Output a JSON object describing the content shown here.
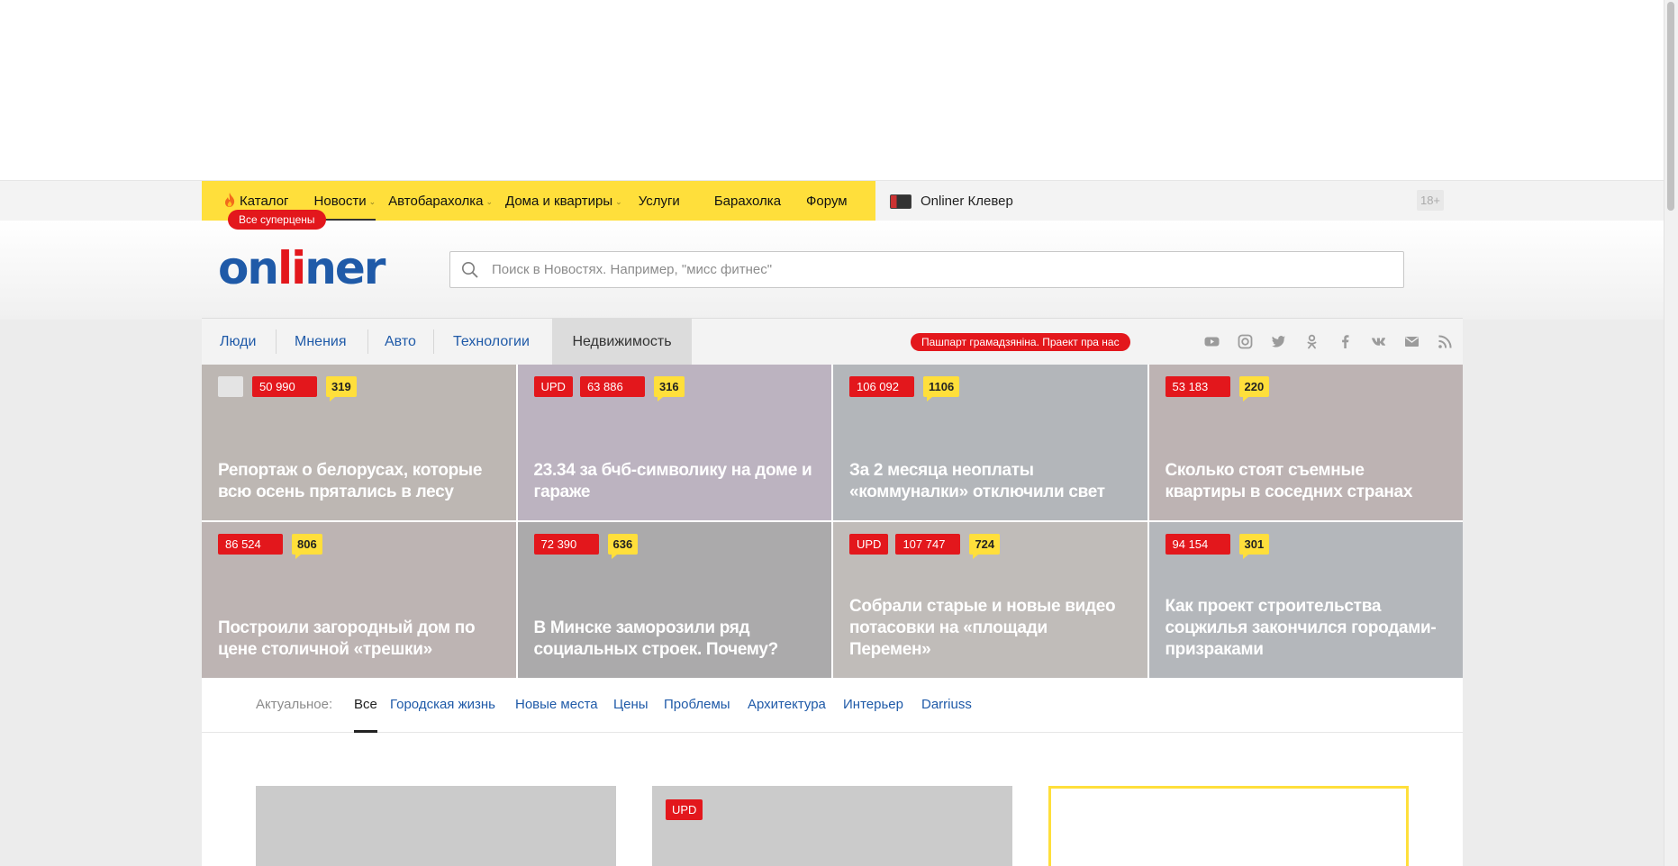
{
  "top_nav": {
    "items": [
      {
        "label": "Каталог",
        "icon": "fire-icon"
      },
      {
        "label": "Новости",
        "has_caret": true,
        "active": true
      },
      {
        "label": "Автобарахолка",
        "has_caret": true
      },
      {
        "label": "Дома и квартиры",
        "has_caret": true
      },
      {
        "label": "Услуги"
      },
      {
        "label": "Барахолка"
      },
      {
        "label": "Форум"
      }
    ],
    "superprice_badge": "Все суперцены",
    "klever_label": "Onliner Клевер",
    "age_badge": "18+"
  },
  "header": {
    "logo": {
      "part1": "on",
      "part2": "li",
      "part3": "ner"
    },
    "search_placeholder": "Поиск в Новостях. Например, \"мисс фитнес\""
  },
  "rubrics": {
    "items": [
      {
        "label": "Люди"
      },
      {
        "label": "Мнения"
      },
      {
        "label": "Авто"
      },
      {
        "label": "Технологии"
      },
      {
        "label": "Недвижимость",
        "active": true
      }
    ],
    "project_badge": "Пашпарт грамадзяніна. Праект пра нас",
    "socials": [
      "youtube-icon",
      "instagram-icon",
      "twitter-icon",
      "odnoklassniki-icon",
      "facebook-icon",
      "vk-icon",
      "mail-icon",
      "rss-icon"
    ]
  },
  "tiles": [
    {
      "views": "50 990",
      "comments": "319",
      "photo": true,
      "title": "Репортаж о белорусах, которые всю осень прятались в лесу",
      "bg": "#bdb7b3"
    },
    {
      "upd": "UPD",
      "views": "63 886",
      "comments": "316",
      "title": "23.34 за бчб-символику на доме и гараже",
      "bg": "#bcb3c0"
    },
    {
      "views": "106 092",
      "comments": "1106",
      "title": "За 2 месяца неоплаты «коммуналки» отключили свет",
      "bg": "#b3b6ba"
    },
    {
      "views": "53 183",
      "comments": "220",
      "title": "Сколько стоят съемные квартиры в соседних странах",
      "bg": "#bdb3b3"
    },
    {
      "views": "86 524",
      "comments": "806",
      "title": "Построили загородный дом по цене столичной «трешки»",
      "bg": "#bdb4b3"
    },
    {
      "views": "72 390",
      "comments": "636",
      "title": "В Минске заморозили ряд социальных строек. Почему?",
      "bg": "#abaaab"
    },
    {
      "upd": "UPD",
      "views": "107 747",
      "comments": "724",
      "title": "Собрали старые и новые видео потасовки на «площади Перемен»",
      "bg": "#c0bcb9"
    },
    {
      "views": "94 154",
      "comments": "301",
      "title": "Как проект строительства соцжилья закончился городами-призраками",
      "bg": "#b4b7bb"
    }
  ],
  "topics": {
    "label": "Актуальное:",
    "items": [
      "Все",
      "Городская жизнь",
      "Новые места",
      "Цены",
      "Проблемы",
      "Архитектура",
      "Интерьер",
      "Darriuss"
    ]
  },
  "cards": [
    {},
    {
      "upd": "UPD"
    }
  ],
  "colors": {
    "brand_yellow": "#ffdf3b",
    "brand_red": "#e3171c",
    "brand_blue": "#1f5aa8"
  }
}
